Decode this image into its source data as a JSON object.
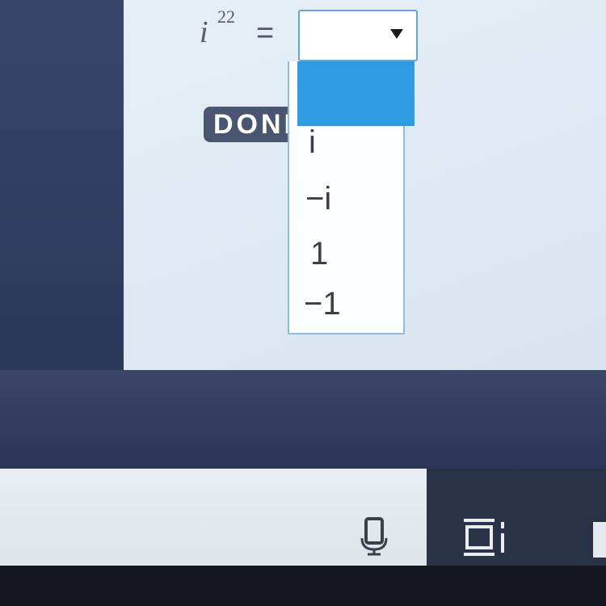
{
  "equation": {
    "base": "i",
    "exponent": "22",
    "equals": "="
  },
  "select": {
    "selected_value": "",
    "arrow_glyph": "▼"
  },
  "dropdown": {
    "options": [
      "",
      "i",
      "−i",
      "1",
      "−1"
    ],
    "highlighted_index": 0
  },
  "done_button": {
    "label": "DONE"
  },
  "taskbar": {
    "icons": [
      "microphone-icon",
      "task-view-icon"
    ]
  },
  "colors": {
    "highlight": "#2d9be0",
    "select_border": "#5fa6de",
    "done_bg": "#4a5670",
    "panel_bg": "#e6eef6"
  }
}
